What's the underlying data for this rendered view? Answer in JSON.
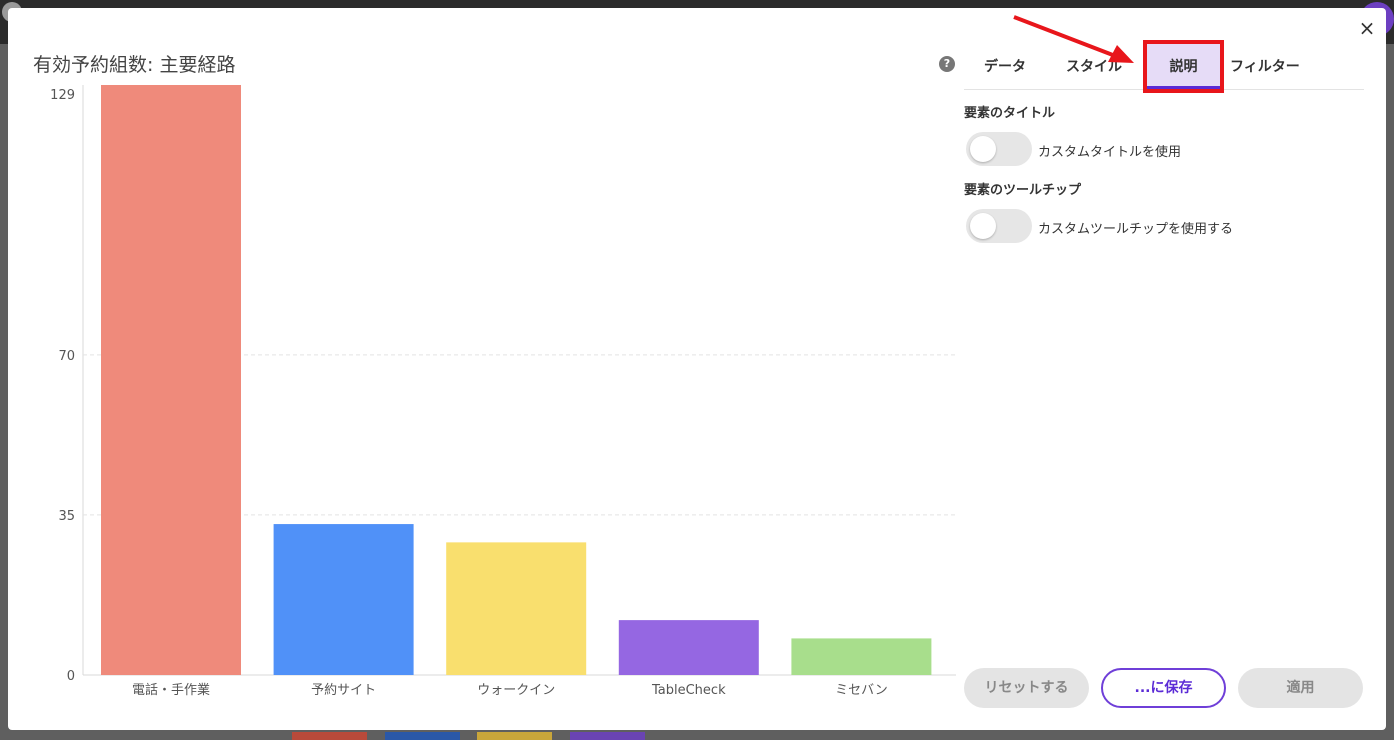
{
  "chart": {
    "title": "有効予約組数: 主要経路",
    "help_icon": "?"
  },
  "chart_data": {
    "type": "bar",
    "title": "有効予約組数: 主要経路",
    "categories": [
      "電話・手作業",
      "予約サイト",
      "ウォークイン",
      "TableCheck",
      "ミセバン"
    ],
    "values": [
      129,
      33,
      29,
      12,
      8
    ],
    "colors": [
      "#ef8a7b",
      "#5091f8",
      "#f9df6e",
      "#9567e2",
      "#a8de8c"
    ],
    "yticks": [
      "0",
      "35",
      "70",
      "129"
    ],
    "ylim": [
      0,
      129
    ],
    "grid": true,
    "legend": "none"
  },
  "panel": {
    "tabs": [
      {
        "label": "データ"
      },
      {
        "label": "スタイル"
      },
      {
        "label": "説明"
      },
      {
        "label": "フィルター"
      }
    ],
    "active_tab": "説明",
    "title_section_label": "要素のタイトル",
    "title_toggle_label": "カスタムタイトルを使用",
    "tooltip_section_label": "要素のツールチップ",
    "tooltip_toggle_label": "カスタムツールチップを使用する"
  },
  "buttons": {
    "reset": "リセットする",
    "save": "...に保存",
    "apply": "適用"
  },
  "close_icon": "×",
  "accent_color": "#5b2bd6",
  "highlight_color": "#e8161b"
}
